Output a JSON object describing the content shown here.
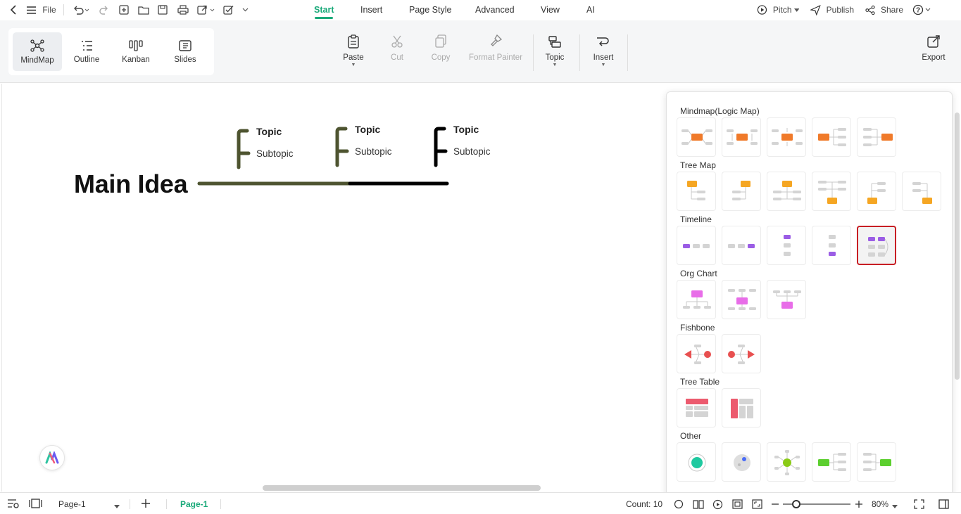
{
  "topbar": {
    "file_label": "File",
    "tabs": [
      {
        "label": "Start"
      },
      {
        "label": "Insert"
      },
      {
        "label": "Page Style"
      },
      {
        "label": "Advanced"
      },
      {
        "label": "View"
      },
      {
        "label": "AI"
      }
    ],
    "pitch_label": "Pitch",
    "publish_label": "Publish",
    "share_label": "Share"
  },
  "ribbon": {
    "views": [
      {
        "label": "MindMap",
        "icon": "mindmap-icon"
      },
      {
        "label": "Outline",
        "icon": "outline-icon"
      },
      {
        "label": "Kanban",
        "icon": "kanban-icon"
      },
      {
        "label": "Slides",
        "icon": "slides-icon"
      }
    ],
    "paste_label": "Paste",
    "cut_label": "Cut",
    "copy_label": "Copy",
    "format_painter_label": "Format Painter",
    "topic_label": "Topic",
    "insert_label": "Insert",
    "export_label": "Export"
  },
  "canvas": {
    "main_idea": "Main Idea",
    "branches": [
      {
        "topic": "Topic",
        "subtopic": "Subtopic"
      },
      {
        "topic": "Topic",
        "subtopic": "Subtopic"
      },
      {
        "topic": "Topic",
        "subtopic": "Subtopic"
      }
    ],
    "colors": {
      "branch_olive": "#4e5430",
      "branch_black": "#000000"
    }
  },
  "layout_panel": {
    "sections": [
      {
        "title": "Mindmap(Logic Map)",
        "count": 5
      },
      {
        "title": "Tree Map",
        "count": 6
      },
      {
        "title": "Timeline",
        "count": 5,
        "selected_index": 4
      },
      {
        "title": "Org Chart",
        "count": 3
      },
      {
        "title": "Fishbone",
        "count": 2
      },
      {
        "title": "Tree Table",
        "count": 2
      },
      {
        "title": "Other",
        "count": 5
      }
    ],
    "colors": {
      "mindmap": "#f07a2a",
      "tree": "#f5a623",
      "timeline": "#9b5de5",
      "org": "#e86de8",
      "fishbone": "#e85050",
      "table": "#ec5a6e",
      "other": "#5ccf2f",
      "selected_border": "#c81e24"
    }
  },
  "statusbar": {
    "page_select": "Page-1",
    "page_tab": "Page-1",
    "count_label": "Count: 10",
    "zoom_label": "80%"
  }
}
